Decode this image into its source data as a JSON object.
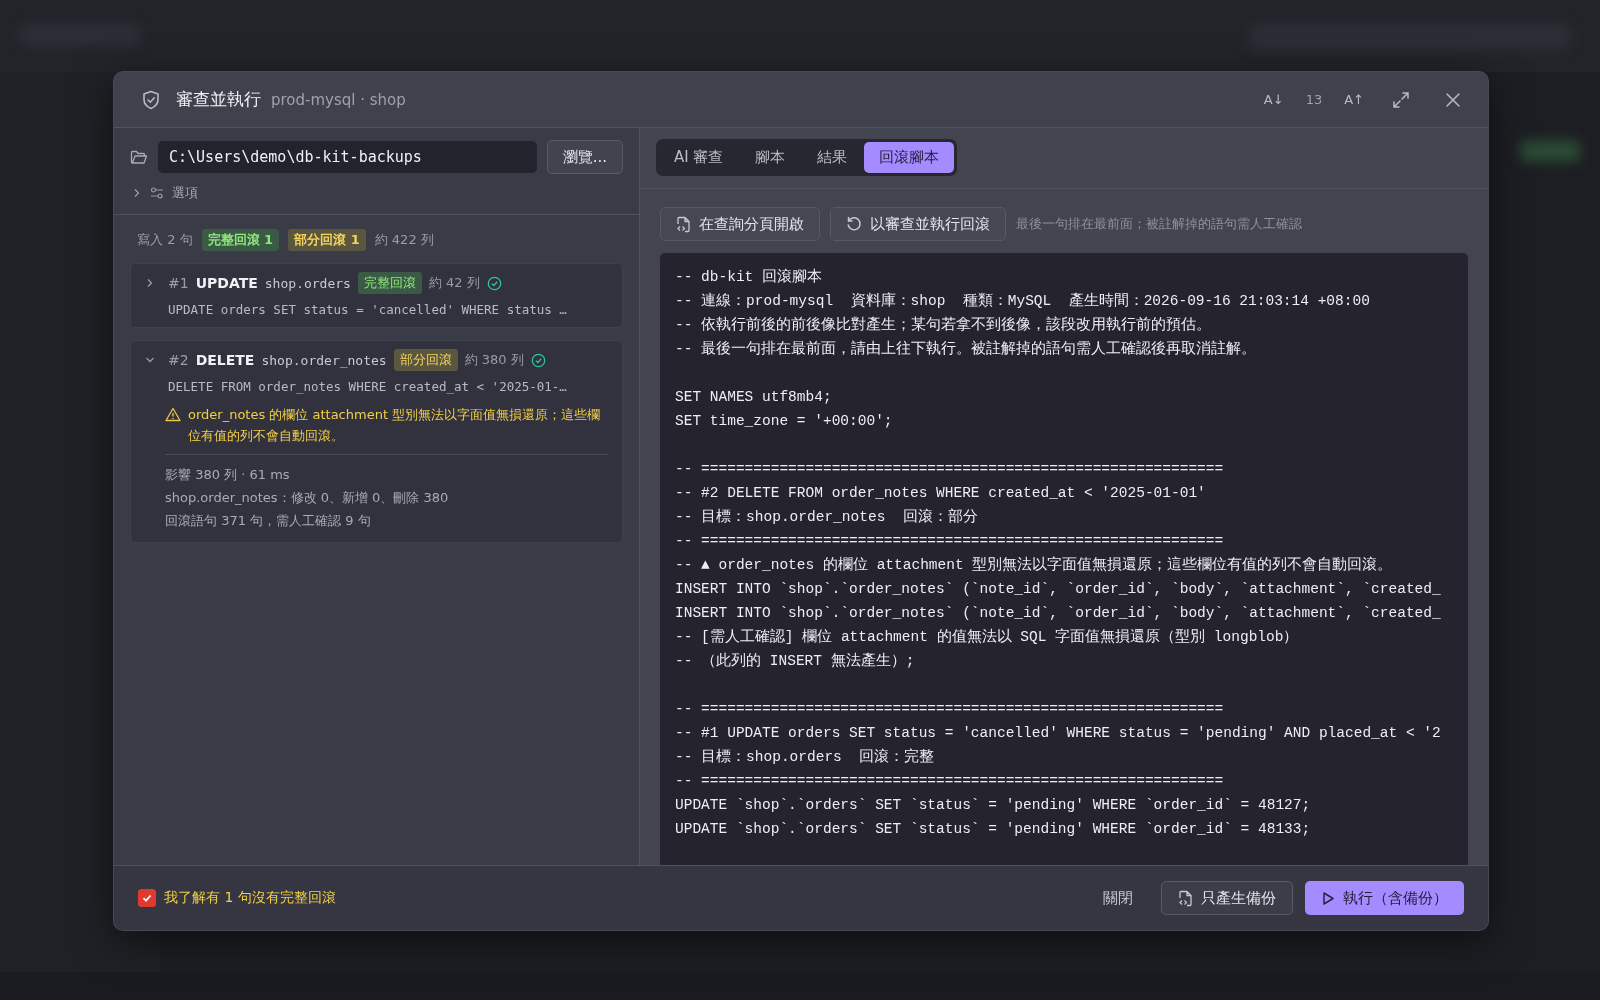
{
  "dialog": {
    "title": "審查並執行",
    "subtitle": "prod-mysql · shop",
    "font_down": "A↓",
    "font_size": "13",
    "font_up": "A↑"
  },
  "left": {
    "path": "C:\\Users\\demo\\db-kit-backups",
    "browse": "瀏覽...",
    "options": {
      "label": "選項",
      "expanded": false
    },
    "summary": {
      "writes": "寫入 2 句",
      "badges": [
        {
          "kind": "full",
          "text": "完整回滾 1"
        },
        {
          "kind": "partial",
          "text": "部分回滾 1"
        }
      ],
      "rows": "約 422 列"
    },
    "statements": [
      {
        "number": "#1",
        "verb": "UPDATE",
        "table": "shop.orders",
        "badge": {
          "kind": "full",
          "text": "完整回滾"
        },
        "rows": "約 42 列",
        "ok": true,
        "expanded": false,
        "sql": "UPDATE orders SET status = 'cancelled' WHERE status …"
      },
      {
        "number": "#2",
        "verb": "DELETE",
        "table": "shop.order_notes",
        "badge": {
          "kind": "partial",
          "text": "部分回滾"
        },
        "rows": "約 380 列",
        "ok": true,
        "expanded": true,
        "sql": "DELETE FROM order_notes WHERE created_at < '2025-01-…",
        "warning": "order_notes 的欄位 attachment 型別無法以字面值無損還原；這些欄位有值的列不會自動回滾。",
        "details": [
          "影響 380 列 · 61 ms",
          "shop.order_notes：修改 0、新增 0、刪除 380",
          "回滾語句 371 句，需人工確認 9 句"
        ]
      }
    ]
  },
  "tabs": [
    {
      "label": "AI 審查",
      "selected": false
    },
    {
      "label": "腳本",
      "selected": false
    },
    {
      "label": "結果",
      "selected": false
    },
    {
      "label": "回滾腳本",
      "selected": true
    }
  ],
  "actions": {
    "open_in_tab": "在查詢分頁開啟",
    "run_rollback": "以審查並執行回滾",
    "hint": "最後一句排在最前面；被註解掉的語句需人工確認"
  },
  "code_blocks": [
    [
      "-- db-kit 回滾腳本",
      "-- 連線：prod-mysql  資料庫：shop  種類：MySQL  產生時間：2026-09-16 21:03:14 +08:00",
      "-- 依執行前後的前後像比對產生；某句若拿不到後像，該段改用執行前的預估。",
      "-- 最後一句排在最前面，請由上往下執行。被註解掉的語句需人工確認後再取消註解。"
    ],
    [
      "SET NAMES utf8mb4;",
      "SET time_zone = '+00:00';"
    ],
    [
      "-- ============================================================",
      "-- #2 DELETE FROM order_notes WHERE created_at < '2025-01-01'",
      "-- 目標：shop.order_notes  回滾：部分",
      "-- ============================================================",
      "-- ▲ order_notes 的欄位 attachment 型別無法以字面值無損還原；這些欄位有值的列不會自動回滾。",
      "INSERT INTO `shop`.`order_notes` (`note_id`, `order_id`, `body`, `attachment`, `created_",
      "INSERT INTO `shop`.`order_notes` (`note_id`, `order_id`, `body`, `attachment`, `created_",
      "-- [需人工確認] 欄位 attachment 的值無法以 SQL 字面值無損還原（型別 longblob）",
      "-- （此列的 INSERT 無法產生）;"
    ],
    [
      "-- ============================================================",
      "-- #1 UPDATE orders SET status = 'cancelled' WHERE status = 'pending' AND placed_at < '2",
      "-- 目標：shop.orders  回滾：完整",
      "-- ============================================================",
      "UPDATE `shop`.`orders` SET `status` = 'pending' WHERE `order_id` = 48127;",
      "UPDATE `shop`.`orders` SET `status` = 'pending' WHERE `order_id` = 48133;"
    ]
  ],
  "footer": {
    "ack": {
      "label": "我了解有 1 句沒有完整回滾",
      "checked": true
    },
    "close": "關閉",
    "backup_only": "只產生備份",
    "execute": "執行（含備份）"
  }
}
